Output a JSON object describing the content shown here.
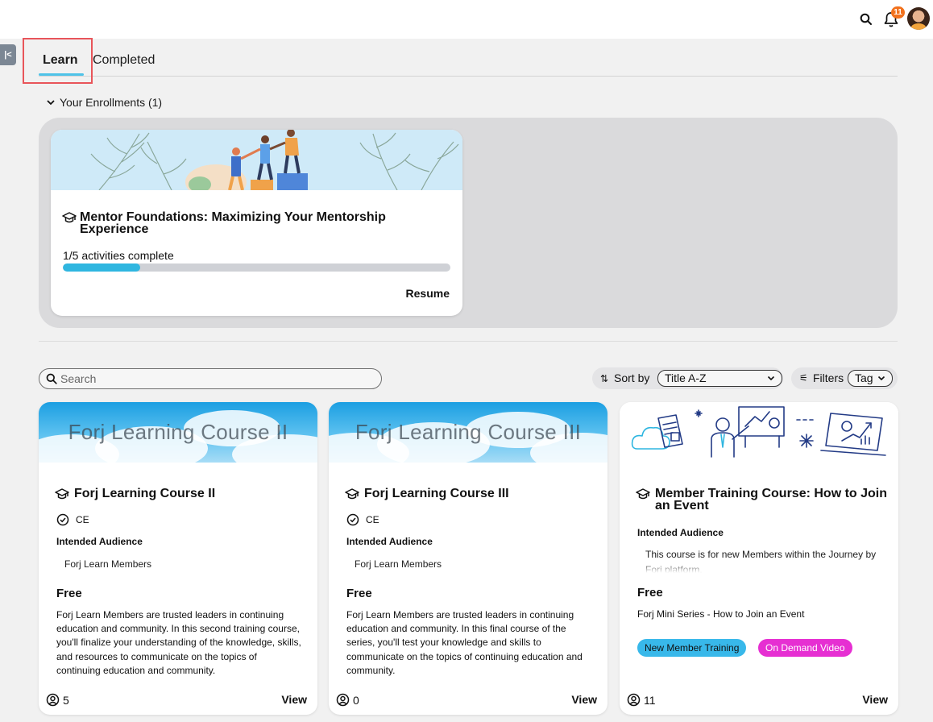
{
  "tabs": [
    {
      "label": "Learn",
      "active": true
    },
    {
      "label": "Completed",
      "active": false
    }
  ],
  "header": {
    "notification_count": "11",
    "icons": [
      "search-icon",
      "bell-icon",
      "avatar"
    ]
  },
  "enrollments": {
    "toggle_label": "Your Enrollments (1)",
    "course": {
      "title": "Mentor Foundations: Maximizing Your Mentorship Experience",
      "progress_text": "1/5 activities complete",
      "progress_fraction": 0.2,
      "action_label": "Resume"
    }
  },
  "controls": {
    "search_placeholder": "Search",
    "sort_label": "Sort by",
    "sort_value": "Title A-Z",
    "filters_label": "Filters",
    "tag_value": "Tag"
  },
  "courses": [
    {
      "banner_text": "Forj Learning Course II",
      "title": "Forj Learning Course II",
      "badge": "CE",
      "audience_label": "Intended Audience",
      "audience": "Forj Learn Members",
      "price": "Free",
      "description": "Forj Learn Members are trusted leaders in continuing education and community. In this second training course, you'll finalize your understanding of the knowledge, skills, and resources to communicate on the topics of continuing education and community.",
      "enrolled": "5",
      "action_label": "View"
    },
    {
      "banner_text": "Forj Learning Course III",
      "title": "Forj Learning Course III",
      "badge": "CE",
      "audience_label": "Intended Audience",
      "audience": "Forj Learn Members",
      "price": "Free",
      "description": "Forj Learn Members are trusted leaders in continuing education and community. In this final course of the series, you'll test your knowledge and skills to communicate on the topics of continuing education and community.",
      "enrolled": "0",
      "action_label": "View"
    },
    {
      "title": "Member Training Course: How to Join an Event",
      "audience_label": "Intended Audience",
      "audience": "This course is for new Members within the Journey by Forj platform.",
      "price": "Free",
      "description": "Forj Mini Series - How to Join an Event",
      "tags": [
        "New Member Training",
        "On Demand Video"
      ],
      "enrolled": "11",
      "action_label": "View"
    }
  ],
  "colors": {
    "accent": "#2fb6e0",
    "badge": "#f2711c",
    "tag_blue": "#38b8ea",
    "tag_pink": "#e62fd2",
    "highlight": "#e8555a"
  }
}
